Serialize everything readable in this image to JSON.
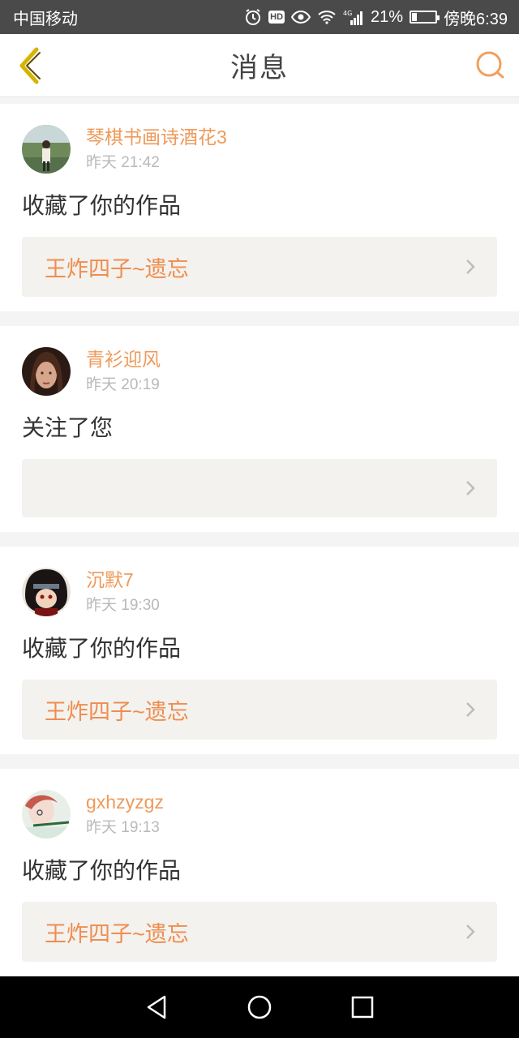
{
  "status_bar": {
    "carrier": "中国移动",
    "signal_label": "4G",
    "battery_percent": "21%",
    "battery_level": 0.21,
    "time": "傍晚6:39",
    "hd_label": "HD"
  },
  "header": {
    "title": "消息",
    "back_icon": "chevron-left-icon",
    "search_icon": "search-icon"
  },
  "colors": {
    "accent": "#ef8d4f",
    "username": "#ef9a5a",
    "back_arrow": "#d7b300"
  },
  "messages": [
    {
      "user": "琴棋书画诗酒花3",
      "time": "昨天 21:42",
      "action": "收藏了你的作品",
      "work": "王炸四子~遗忘"
    },
    {
      "user": "青衫迎风",
      "time": "昨天 20:19",
      "action": "关注了您",
      "work": ""
    },
    {
      "user": "沉默7",
      "time": "昨天 19:30",
      "action": "收藏了你的作品",
      "work": "王炸四子~遗忘"
    },
    {
      "user": "gxhzyzgz",
      "time": "昨天 19:13",
      "action": "收藏了你的作品",
      "work": "王炸四子~遗忘"
    }
  ],
  "nav_bar": {
    "back": "nav-back-icon",
    "home": "nav-home-icon",
    "recents": "nav-recents-icon"
  }
}
